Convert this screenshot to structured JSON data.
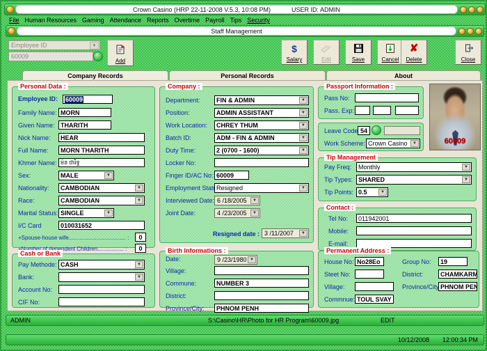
{
  "window": {
    "title": "Crown Casino  (HRP 22-11-2008 V.5.3, 10:08 PM)",
    "user": "USER ID: ADMIN",
    "sub_title": "Staff Management"
  },
  "menu": [
    "File",
    "Human Resources",
    "Gaming",
    "Attendance",
    "Reports",
    "Overtime",
    "Payroll",
    "Tips",
    "Security"
  ],
  "toolbar": {
    "employee_filter_placeholder": "Employee ID",
    "employee_id_value": "60009",
    "buttons": [
      {
        "label": "Add",
        "icon": "add-record-icon",
        "disabled": false
      },
      {
        "label": "Salary",
        "icon": "dollar-icon",
        "disabled": false
      },
      {
        "label": "Edit",
        "icon": "pencil-icon",
        "disabled": true
      },
      {
        "label": "Save",
        "icon": "floppy-disk-icon",
        "disabled": false
      },
      {
        "label": "Cancel",
        "icon": "cancel-icon",
        "disabled": false
      },
      {
        "label": "Delete",
        "icon": "red-x-icon",
        "disabled": false
      },
      {
        "label": "Close",
        "icon": "exit-door-icon",
        "disabled": false
      }
    ]
  },
  "tabs": [
    {
      "label": "Company Records",
      "selected": true
    },
    {
      "label": "Personal Records",
      "selected": false
    },
    {
      "label": "About",
      "selected": false
    }
  ],
  "personal_data": {
    "title": "Personal Data :",
    "employee_id_label": "Employee ID:",
    "employee_id": "60009",
    "family_name_label": "Family Name:",
    "family_name": "MORN",
    "given_name_label": "Given Name:",
    "given_name": "THARITH",
    "nick_name_label": "Nick Name:",
    "nick_name": "HEAR",
    "full_name_label": "Full Name:",
    "full_name": "MORN THARITH",
    "khmer_name_label": "Khmer Name:",
    "khmer_name": "ម៉ន ថារិទ្ធ",
    "sex_label": "Sex:",
    "sex": "MALE",
    "nationality_label": "Nationality:",
    "nationality": "CAMBODIAN",
    "race_label": "Race:",
    "race": "CAMBODIAN",
    "marital_status_label": "Marital Status:",
    "marital_status": "SINGLE",
    "ic_card_label": "I/C Card",
    "ic_card": "010031652",
    "spouse_label": "+Spouse-house wife..................................... :",
    "spouse_count": "0",
    "children_label": "+Number of dependent Children................. :",
    "children_count": "0"
  },
  "cash_or_bank": {
    "title": "Cash or Bank",
    "pay_method_label": "Pay Methode:",
    "pay_method": "CASH",
    "bank_label": "Bank:",
    "bank": "",
    "account_no_label": "Account No:",
    "account_no": "",
    "cif_no_label": "CIF No:",
    "cif_no": ""
  },
  "company": {
    "title": "Company :",
    "department_label": "Department:",
    "department": "FIN & ADMIN",
    "position_label": "Position:",
    "position": "ADMIN ASSISTANT",
    "work_location_label": "Work Location:",
    "work_location": "CHREY THUM",
    "batch_id_label": "Batch ID:",
    "batch_id": "ADM - FIN & ADMIN",
    "duty_time_label": "Duty Time:",
    "duty_time": "2 (0700 - 1600)",
    "locker_no_label": "Locker No:",
    "locker_no": "",
    "finger_id_label": "Finger ID/AC No:",
    "finger_id": "60009",
    "employment_status_label": "Employment Status:",
    "employment_status": "Resigned",
    "interviewed_date_label": "Interviewed Date:",
    "interviewed_date": "6 /18/2005",
    "joint_date_label": "Joint Date:",
    "joint_date": "4 /23/2005",
    "resigned_date_label": "Resigned date :",
    "resigned_date": "3 /11/2007"
  },
  "birth": {
    "title": "Birth Informations :",
    "date_label": "Date:",
    "date": "9 /23/1980",
    "village_label": "Village:",
    "village": "",
    "commune_label": "Commune:",
    "commune": "NUMBER 3",
    "district_label": "District:",
    "district": "",
    "province_label": "Province/City:",
    "province": "PHNOM PENH"
  },
  "passport": {
    "title": "Passport Information :",
    "pass_no_label": "Pass No:",
    "pass_no": "",
    "pass_exp_label": "Pass. Exp:",
    "pass_exp_day": "",
    "pass_exp_month": "",
    "pass_exp_year": ""
  },
  "leave": {
    "leave_code_label": "Leave Code:",
    "leave_code": "54",
    "leave_note": "",
    "work_scheme_label": "Work Scheme:",
    "work_scheme": "Crown Casino"
  },
  "tip_management": {
    "title": "Tip Management",
    "pay_freq_label": "Pay Freq:",
    "pay_freq": "Monthly",
    "tip_types_label": "Tip Types:",
    "tip_types": "SHARED",
    "tip_points_label": "Tip Points:",
    "tip_points": "0.5"
  },
  "contact": {
    "title": "Contact :",
    "tel_label": "Tel No:",
    "tel": "011942001",
    "mobile_label": "Mobile:",
    "mobile": "",
    "email_label": "E-mail:",
    "email": ""
  },
  "permanent_address": {
    "title": "Permanent Address :",
    "house_no_label": "House No:",
    "house_no": "No28Eo",
    "street_no_label": "Steet No:",
    "street_no": "",
    "village_label": "Village:",
    "village": "",
    "commune_label": "Commnue:",
    "commune": "TOUL SVAY P",
    "group_no_label": "Group No:",
    "group_no": "19",
    "district_label": "District:",
    "district": "CHAMKARMO",
    "province_label": "Province/City:",
    "province": "PHNOM PENH"
  },
  "photo": {
    "employee_id_overlay": "60009"
  },
  "statusbar": {
    "user": "ADMIN",
    "path": "S:\\Casino\\HR\\Photo for HR Program\\60009.jpg",
    "mode": "EDIT",
    "date": "10/12/2008",
    "time": "12:00:34 PM"
  },
  "colors": {
    "title_green": "#37b547",
    "panel_green": "#96e0a0",
    "label_blue": "#0b2aa8",
    "panel_title_red": "#d00000",
    "form_bg": "#e8e5d6"
  }
}
